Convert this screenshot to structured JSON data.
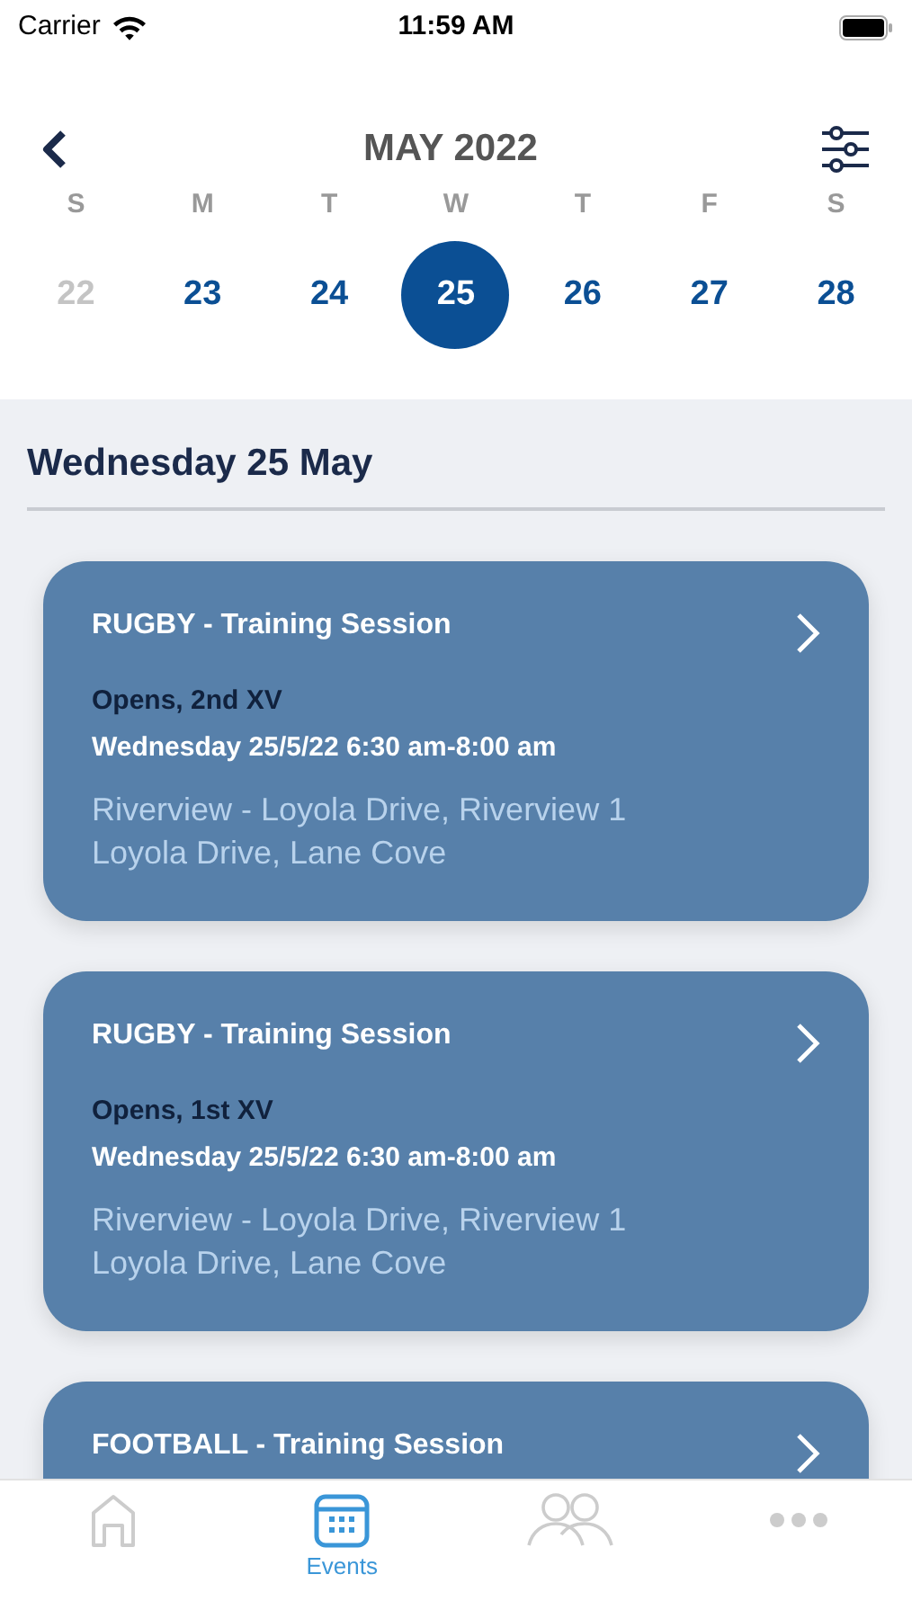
{
  "status_bar": {
    "carrier": "Carrier",
    "time": "11:59 AM"
  },
  "header": {
    "title": "MAY 2022"
  },
  "week": [
    {
      "letter": "S",
      "date": "22",
      "dimmed": true,
      "selected": false
    },
    {
      "letter": "M",
      "date": "23",
      "dimmed": false,
      "selected": false
    },
    {
      "letter": "T",
      "date": "24",
      "dimmed": false,
      "selected": false
    },
    {
      "letter": "W",
      "date": "25",
      "dimmed": false,
      "selected": true
    },
    {
      "letter": "T",
      "date": "26",
      "dimmed": false,
      "selected": false
    },
    {
      "letter": "F",
      "date": "27",
      "dimmed": false,
      "selected": false
    },
    {
      "letter": "S",
      "date": "28",
      "dimmed": false,
      "selected": false
    }
  ],
  "section_title": "Wednesday 25 May",
  "events": [
    {
      "title": "RUGBY - Training Session",
      "team": "Opens, 2nd XV",
      "when": "Wednesday 25/5/22 6:30 am-8:00 am",
      "location": "Riverview - Loyola Drive, Riverview 1 Loyola Drive, Lane Cove"
    },
    {
      "title": "RUGBY - Training Session",
      "team": "Opens, 1st XV",
      "when": "Wednesday 25/5/22 6:30 am-8:00 am",
      "location": "Riverview - Loyola Drive, Riverview 1 Loyola Drive, Lane Cove"
    },
    {
      "title": "FOOTBALL - Training Session"
    }
  ],
  "tab_bar": [
    {
      "kind": "home",
      "selected": false
    },
    {
      "kind": "events",
      "label": "Events",
      "selected": true
    },
    {
      "kind": "people",
      "selected": false
    },
    {
      "kind": "more",
      "selected": false
    }
  ]
}
